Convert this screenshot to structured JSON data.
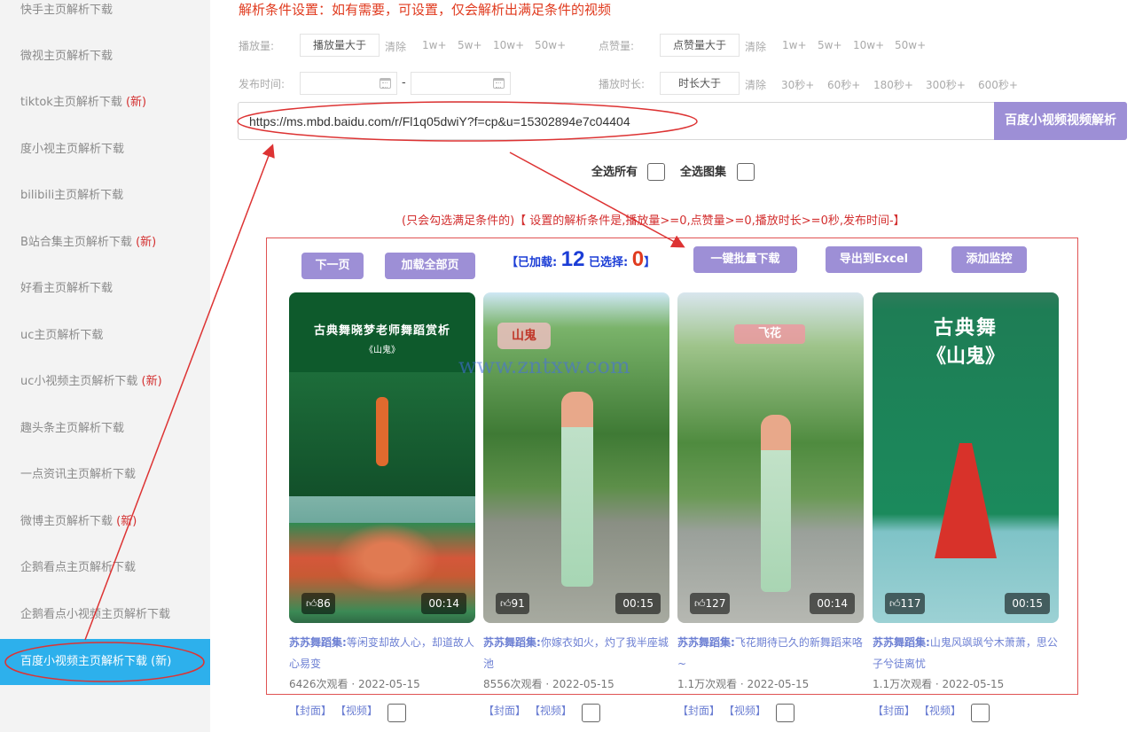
{
  "sidebar": {
    "items": [
      {
        "label": "快手主页解析下载",
        "new": ""
      },
      {
        "label": "微视主页解析下载",
        "new": ""
      },
      {
        "label": "tiktok主页解析下载",
        "new": "(新)"
      },
      {
        "label": "度小视主页解析下载",
        "new": ""
      },
      {
        "label": "bilibili主页解析下载",
        "new": ""
      },
      {
        "label": "B站合集主页解析下载",
        "new": "(新)"
      },
      {
        "label": "好看主页解析下载",
        "new": ""
      },
      {
        "label": "uc主页解析下载",
        "new": ""
      },
      {
        "label": "uc小视频主页解析下载",
        "new": "(新)"
      },
      {
        "label": "趣头条主页解析下载",
        "new": ""
      },
      {
        "label": "一点资讯主页解析下载",
        "new": ""
      },
      {
        "label": "微博主页解析下载",
        "new": "(新)"
      },
      {
        "label": "企鹅看点主页解析下载",
        "new": ""
      },
      {
        "label": "企鹅看点小视频主页解析下载",
        "new": ""
      },
      {
        "label": "百度小视频主页解析下载",
        "new": "(新)"
      }
    ]
  },
  "filters": {
    "title": "解析条件设置：如有需要，可设置，仅会解析出满足条件的视频",
    "play_label": "播放量:",
    "play_box": "播放量大于",
    "play_clear": "清除",
    "play_opts": [
      "1w+",
      "5w+",
      "10w+",
      "50w+"
    ],
    "like_label": "点赞量:",
    "like_box": "点赞量大于",
    "like_clear": "清除",
    "like_opts": [
      "1w+",
      "5w+",
      "10w+",
      "50w+"
    ],
    "date_label": "发布时间:",
    "date_sep": "-",
    "dur_label": "播放时长:",
    "dur_box": "时长大于",
    "dur_clear": "清除",
    "dur_opts": [
      "30秒+",
      "60秒+",
      "180秒+",
      "300秒+",
      "600秒+"
    ]
  },
  "search": {
    "url": "https://ms.mbd.baidu.com/r/Fl1q05dwiY?f=cp&u=15302894e7c04404",
    "button": "百度小视频视频解析"
  },
  "select": {
    "all": "全选所有",
    "all_album": "全选图集"
  },
  "hint": "(只会勾选满足条件的)【 设置的解析条件是,播放量>=0,点赞量>=0,播放时长>=0秒,发布时间-】",
  "actions": {
    "next_page": "下一页",
    "load_all": "加载全部页",
    "loaded_prefix": "【已加载:",
    "loaded_count": "12",
    "selected_prefix": "已选择:",
    "selected_count": "0",
    "loaded_suffix": "】",
    "batch_download": "一键批量下载",
    "export_excel": "导出到Excel",
    "add_monitor": "添加监控"
  },
  "watermark": "www.zntxw.com",
  "videos": [
    {
      "caption1": "古典舞晓梦老师舞蹈赏析",
      "caption2": "《山鬼》",
      "likes": "86",
      "duration": "00:14",
      "author": "苏苏舞蹈集:",
      "title": "等闲变却故人心，却道故人心易变",
      "meta": "6426次观看 · 2022-05-15"
    },
    {
      "caption1": "山鬼",
      "caption2": "",
      "likes": "91",
      "duration": "00:15",
      "author": "苏苏舞蹈集:",
      "title": "你嫁衣如火，灼了我半座城池",
      "meta": "8556次观看 · 2022-05-15"
    },
    {
      "caption1": "飞花",
      "caption2": "",
      "likes": "127",
      "duration": "00:14",
      "author": "苏苏舞蹈集:",
      "title": "飞花期待已久的新舞蹈来咯~",
      "meta": "1.1万次观看 · 2022-05-15"
    },
    {
      "caption1": "古典舞",
      "caption2": "《山鬼》",
      "likes": "117",
      "duration": "00:15",
      "author": "苏苏舞蹈集:",
      "title": "山鬼风飒飒兮木萧萧，思公子兮徒离忧",
      "meta": "1.1万次观看 · 2022-05-15"
    }
  ],
  "dl": {
    "cover": "【封面】",
    "video": "【视频】"
  }
}
